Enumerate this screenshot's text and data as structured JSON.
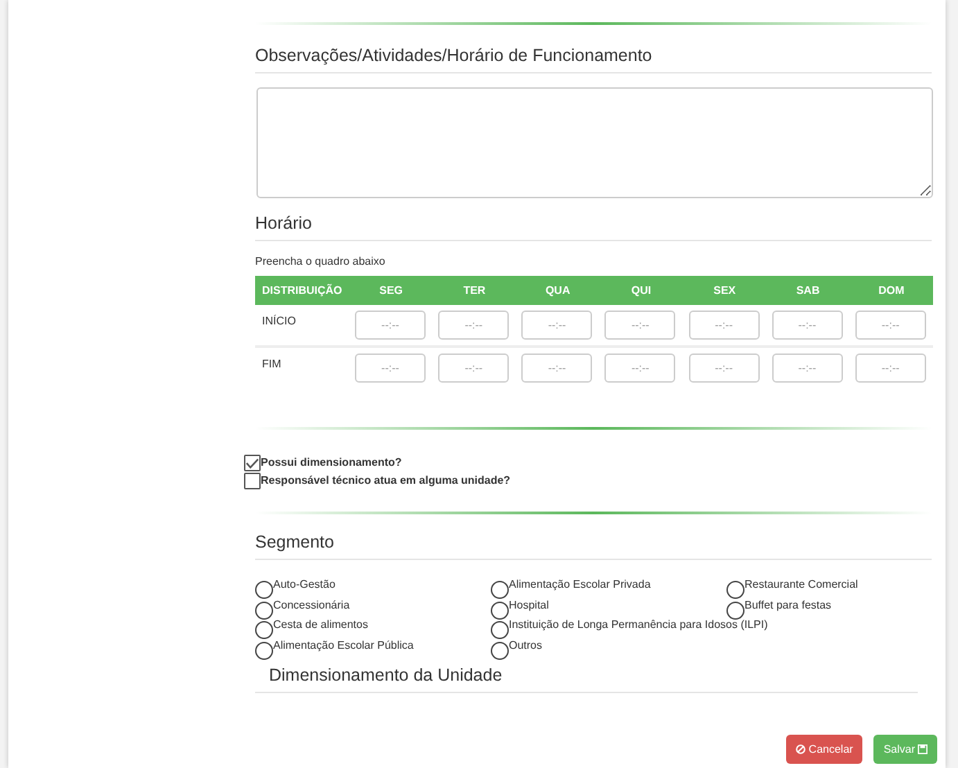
{
  "observations": {
    "title": "Observações/Atividades/Horário de Funcionamento"
  },
  "schedule": {
    "title": "Horário",
    "hint": "Preencha o quadro abaixo",
    "columns": [
      "DISTRIBUIÇÃO",
      "SEG",
      "TER",
      "QUA",
      "QUI",
      "SEX",
      "SAB",
      "DOM"
    ],
    "rows": [
      {
        "label": "INÍCIO",
        "placeholder": "--:--"
      },
      {
        "label": "FIM",
        "placeholder": "--:--"
      }
    ]
  },
  "options": [
    {
      "label": "Possui dimensionamento?",
      "checked": true
    },
    {
      "label": "Responsável técnico atua em alguma unidade?",
      "checked": false
    }
  ],
  "segment": {
    "title": "Segmento",
    "columns": [
      [
        {
          "label": "Auto-Gestão",
          "selected": false
        },
        {
          "label": "Concessionária",
          "selected": false
        },
        {
          "label": "Cesta de alimentos",
          "selected": false
        },
        {
          "label": "Alimentação Escolar Pública",
          "selected": false
        }
      ],
      [
        {
          "label": "Alimentação Escolar Privada",
          "selected": false
        },
        {
          "label": "Hospital",
          "selected": false
        },
        {
          "label": "Instituição de Longa Permanência para Idosos (ILPI)",
          "selected": false
        },
        {
          "label": "Outros",
          "selected": false
        }
      ],
      [
        {
          "label": "Restaurante Comercial",
          "selected": false
        },
        {
          "label": "Buffet para festas",
          "selected": false
        }
      ]
    ]
  },
  "unit": {
    "title": "Dimensionamento da Unidade"
  },
  "buttons": {
    "cancel": "Cancelar",
    "save": "Salvar"
  }
}
